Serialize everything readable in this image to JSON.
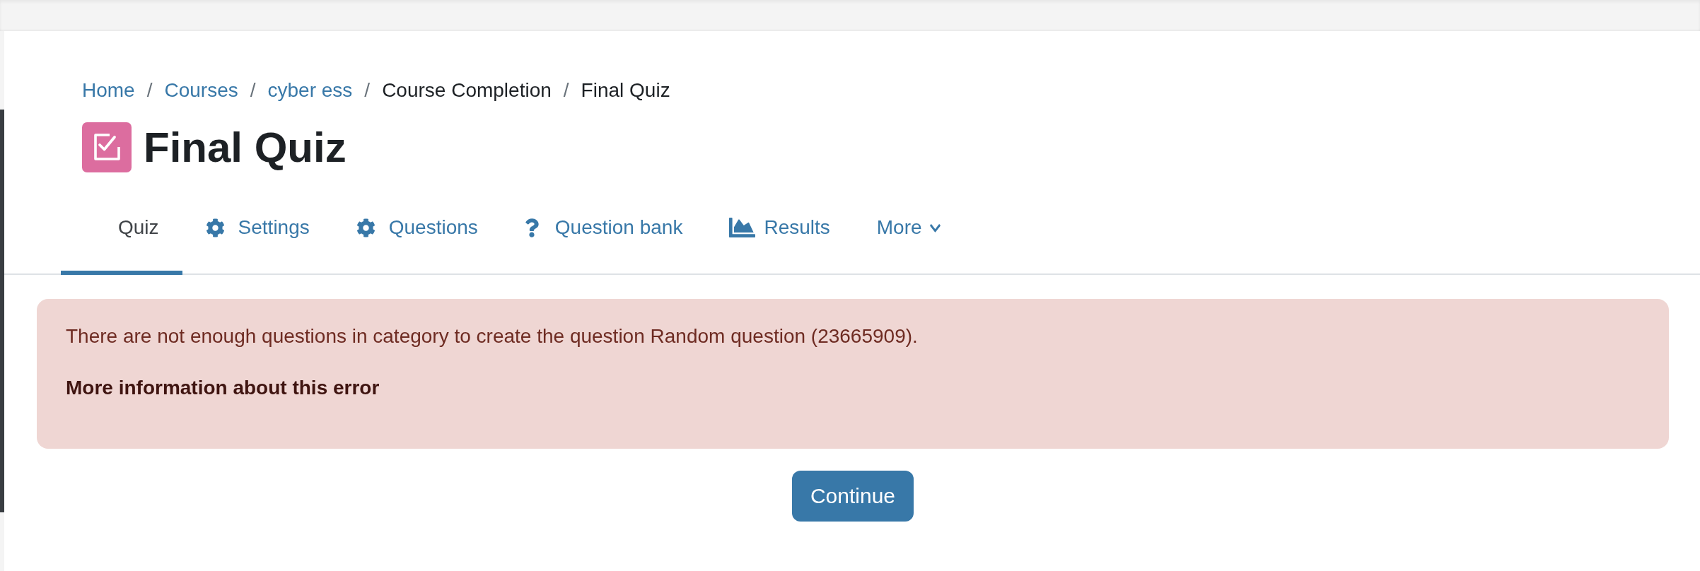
{
  "breadcrumb": [
    {
      "label": "Home",
      "link": true
    },
    {
      "separator": "/",
      "label": "Courses",
      "link": true
    },
    {
      "separator": "/",
      "label": "cyber ess",
      "link": true
    },
    {
      "separator": "/",
      "label": "Course Completion",
      "link": false
    },
    {
      "separator": "/",
      "label": "Final Quiz",
      "link": false
    }
  ],
  "page": {
    "title": "Final Quiz"
  },
  "tabs": [
    {
      "label": "Quiz",
      "kind": "plain",
      "selected": true
    },
    {
      "label": "Settings",
      "kind": "settings",
      "selected": false
    },
    {
      "label": "Questions",
      "kind": "questions",
      "selected": false
    },
    {
      "label": "Question bank",
      "kind": "bank",
      "selected": false
    },
    {
      "label": "Results",
      "kind": "results",
      "selected": false
    },
    {
      "label": "More",
      "kind": "more",
      "selected": false
    }
  ],
  "alert": {
    "message": "There are not enough questions in category to create the question Random question (23665909).",
    "details_link": "More information about this error"
  },
  "continue_button": {
    "label": "Continue"
  }
}
